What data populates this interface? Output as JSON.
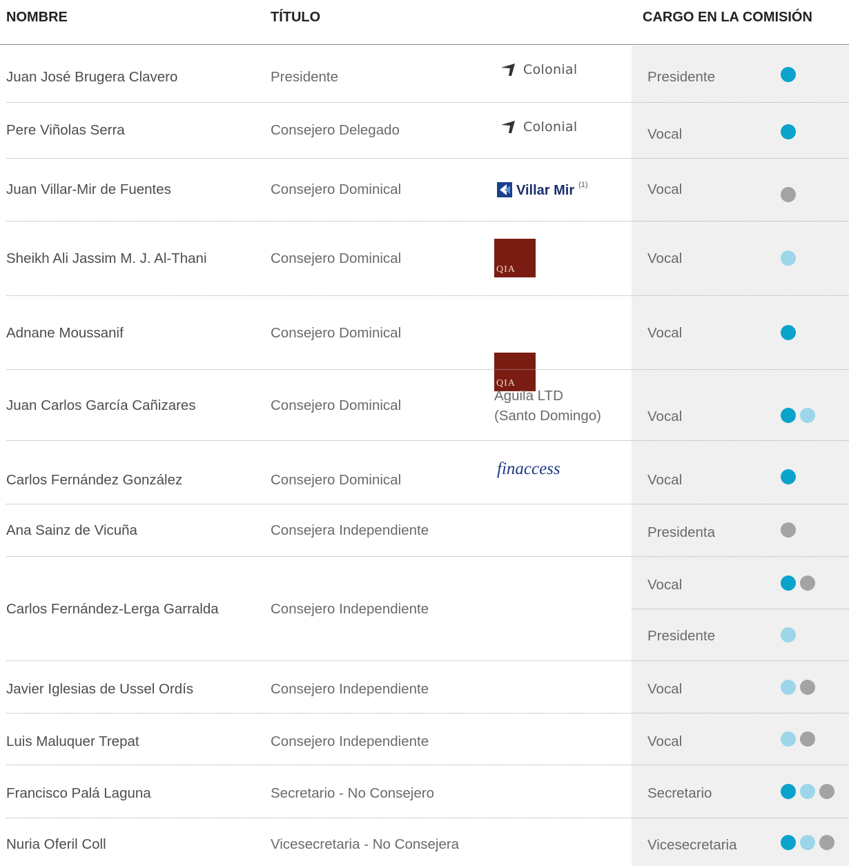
{
  "headers": {
    "nombre": "NOMBRE",
    "titulo": "TÍTULO",
    "cargo": "CARGO EN LA COMISIÓN"
  },
  "colors": {
    "dark_blue": "#0aa3cc",
    "light_blue": "#9bd6ea",
    "gray": "#a3a3a3",
    "band": "#f0f0f0"
  },
  "rows": [
    {
      "name": "Juan José Brugera Clavero",
      "title": "Presidente",
      "logo": "colonial-logo",
      "logo_text": "Colonial",
      "cargo": "Presidente",
      "dots": [
        "dark_blue"
      ]
    },
    {
      "name": "Pere Viñolas Serra",
      "title": "Consejero Delegado",
      "logo": "colonial-logo",
      "logo_text": "Colonial",
      "cargo": "Vocal",
      "dots": [
        "dark_blue"
      ]
    },
    {
      "name": "Juan Villar-Mir de Fuentes",
      "title": "Consejero Dominical",
      "logo": "villar-mir-logo",
      "logo_text": "Villar Mir",
      "logo_sup": "(1)",
      "cargo": "Vocal",
      "dots": [
        "gray"
      ]
    },
    {
      "name": "Sheikh Ali Jassim M. J. Al-Thani",
      "title": "Consejero Dominical",
      "logo": "qia-logo",
      "logo_text": "QIA",
      "cargo": "Vocal",
      "dots": [
        "light_blue"
      ]
    },
    {
      "name": "Adnane Moussanif",
      "title": "Consejero Dominical",
      "logo": "qia-logo",
      "logo_text": "QIA",
      "cargo": "Vocal",
      "dots": [
        "dark_blue"
      ]
    },
    {
      "name": "Juan Carlos García Cañizares",
      "title": "Consejero Dominical",
      "logo": "text",
      "logo_lines": [
        "Aguila LTD",
        "(Santo Domingo)"
      ],
      "cargo": "Vocal",
      "dots": [
        "dark_blue",
        "light_blue"
      ]
    },
    {
      "name": "Carlos Fernández González",
      "title": "Consejero Dominical",
      "logo": "finaccess-logo",
      "logo_text": "finaccess",
      "cargo": "Vocal",
      "dots": [
        "dark_blue"
      ]
    },
    {
      "name": "Ana Sainz de Vicuña",
      "title": "Consejera Independiente",
      "cargo": "Presidenta",
      "dots": [
        "gray"
      ]
    },
    {
      "name": "Carlos Fernández-Lerga Garralda",
      "title": "Consejero Independiente",
      "cargos": [
        {
          "cargo": "Vocal",
          "dots": [
            "dark_blue",
            "gray"
          ]
        },
        {
          "cargo": "Presidente",
          "dots": [
            "light_blue"
          ]
        }
      ]
    },
    {
      "name": "Javier Iglesias de Ussel Ordís",
      "title": "Consejero Independiente",
      "cargo": "Vocal",
      "dots": [
        "light_blue",
        "gray"
      ]
    },
    {
      "name": "Luis Maluquer Trepat",
      "title": "Consejero Independiente",
      "cargo": "Vocal",
      "dots": [
        "light_blue",
        "gray"
      ]
    },
    {
      "name": "Francisco Palá Laguna",
      "title": "Secretario - No Consejero",
      "cargo": "Secretario",
      "dots": [
        "dark_blue",
        "light_blue",
        "gray"
      ]
    },
    {
      "name": "Nuria Oferil Coll",
      "title": "Vicesecretaria - No Consejera",
      "cargo": "Vicesecretaria",
      "dots": [
        "dark_blue",
        "light_blue",
        "gray"
      ]
    }
  ]
}
